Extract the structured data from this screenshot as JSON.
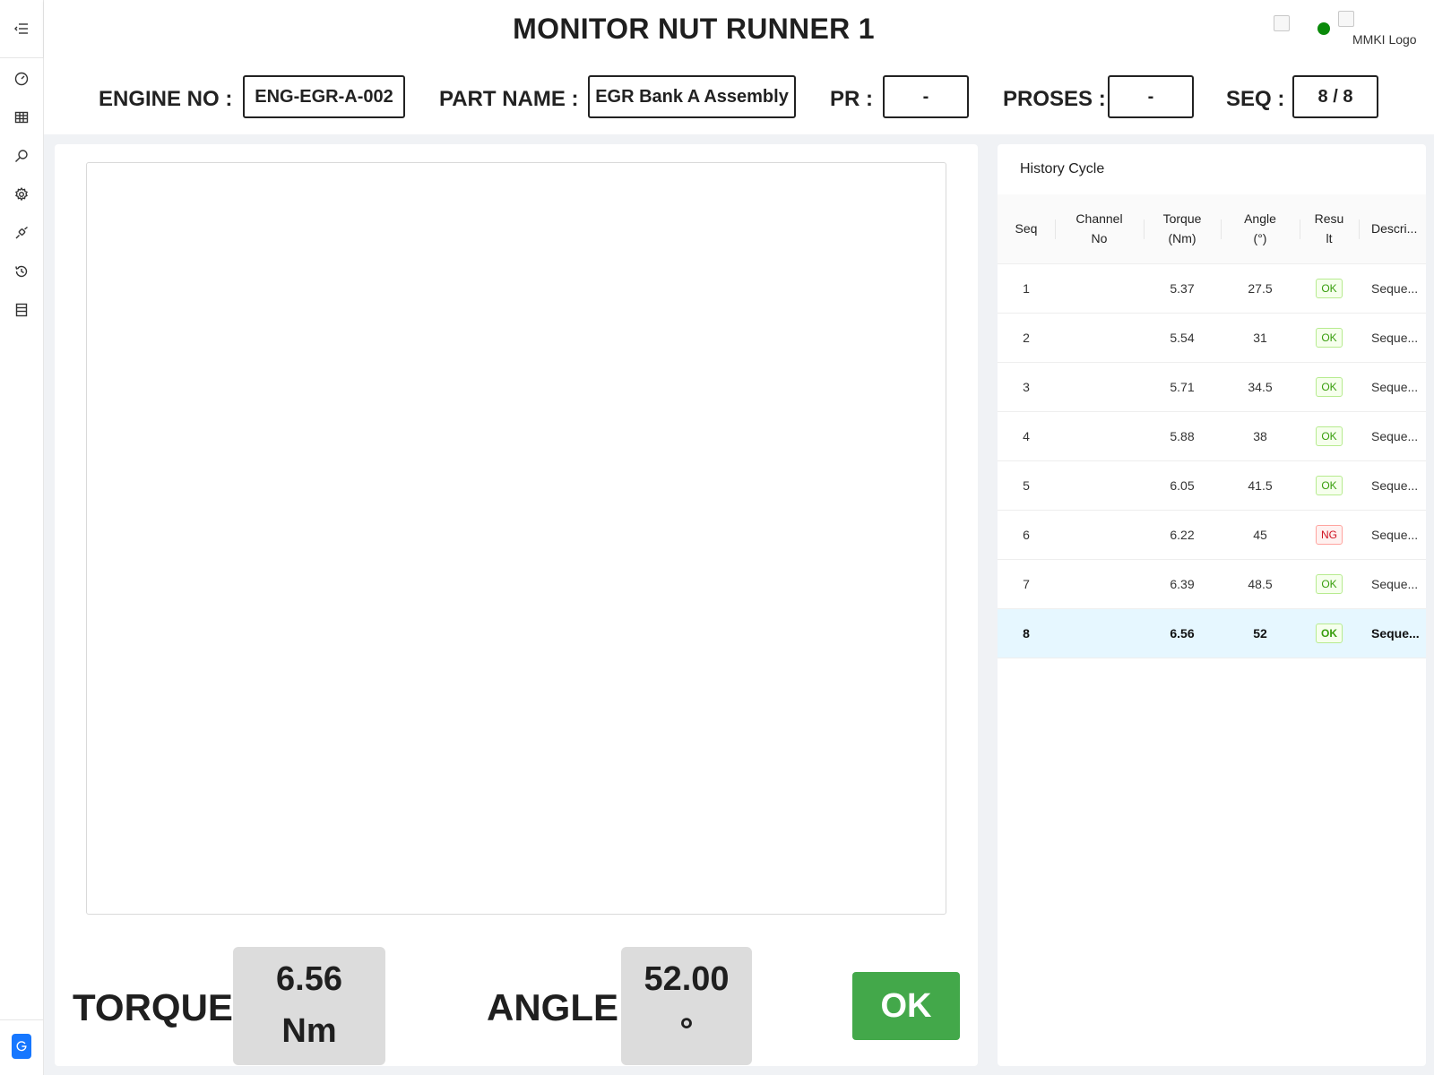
{
  "header": {
    "title": "MONITOR NUT RUNNER 1",
    "logo_alt": "MMKI Logo",
    "status_color": "#0a8a0a"
  },
  "sidebar": {
    "items": [
      {
        "icon": "menu-fold-icon"
      },
      {
        "icon": "dashboard-icon"
      },
      {
        "icon": "table-icon"
      },
      {
        "icon": "search-icon"
      },
      {
        "icon": "gear-icon"
      },
      {
        "icon": "api-icon"
      },
      {
        "icon": "history-icon"
      },
      {
        "icon": "database-icon"
      }
    ],
    "bottom_icon": "google-icon"
  },
  "info": {
    "engine_label": "ENGINE NO :",
    "engine_value": "ENG-EGR-A-002",
    "part_label": "PART NAME :",
    "part_value": "EGR Bank A Assembly",
    "pr_label": "PR :",
    "pr_value": "-",
    "proses_label": "PROSES :",
    "proses_value": "-",
    "seq_label": "SEQ :",
    "seq_value": "8 / 8"
  },
  "readout": {
    "torque_label": "TORQUE",
    "torque_value": "6.56",
    "torque_unit": "Nm",
    "angle_label": "ANGLE",
    "angle_value": "52.00",
    "angle_unit": "°",
    "result": "OK",
    "result_color": "#43a84a"
  },
  "history": {
    "title": "History Cycle",
    "columns": [
      "Seq",
      "Channel No",
      "Torque (Nm)",
      "Angle (°)",
      "Result",
      "Descri..."
    ],
    "column_display": [
      "Seq",
      "Channel\nNo",
      "Torque\n(Nm)",
      "Angle\n(°)",
      "Resu\nlt",
      "Descri..."
    ],
    "rows": [
      {
        "seq": "1",
        "channel": "",
        "torque": "5.37",
        "angle": "27.5",
        "result": "OK",
        "desc": "Seque..."
      },
      {
        "seq": "2",
        "channel": "",
        "torque": "5.54",
        "angle": "31",
        "result": "OK",
        "desc": "Seque..."
      },
      {
        "seq": "3",
        "channel": "",
        "torque": "5.71",
        "angle": "34.5",
        "result": "OK",
        "desc": "Seque..."
      },
      {
        "seq": "4",
        "channel": "",
        "torque": "5.88",
        "angle": "38",
        "result": "OK",
        "desc": "Seque..."
      },
      {
        "seq": "5",
        "channel": "",
        "torque": "6.05",
        "angle": "41.5",
        "result": "OK",
        "desc": "Seque..."
      },
      {
        "seq": "6",
        "channel": "",
        "torque": "6.22",
        "angle": "45",
        "result": "NG",
        "desc": "Seque..."
      },
      {
        "seq": "7",
        "channel": "",
        "torque": "6.39",
        "angle": "48.5",
        "result": "OK",
        "desc": "Seque..."
      },
      {
        "seq": "8",
        "channel": "",
        "torque": "6.56",
        "angle": "52",
        "result": "OK",
        "desc": "Seque...",
        "active": true
      }
    ]
  }
}
